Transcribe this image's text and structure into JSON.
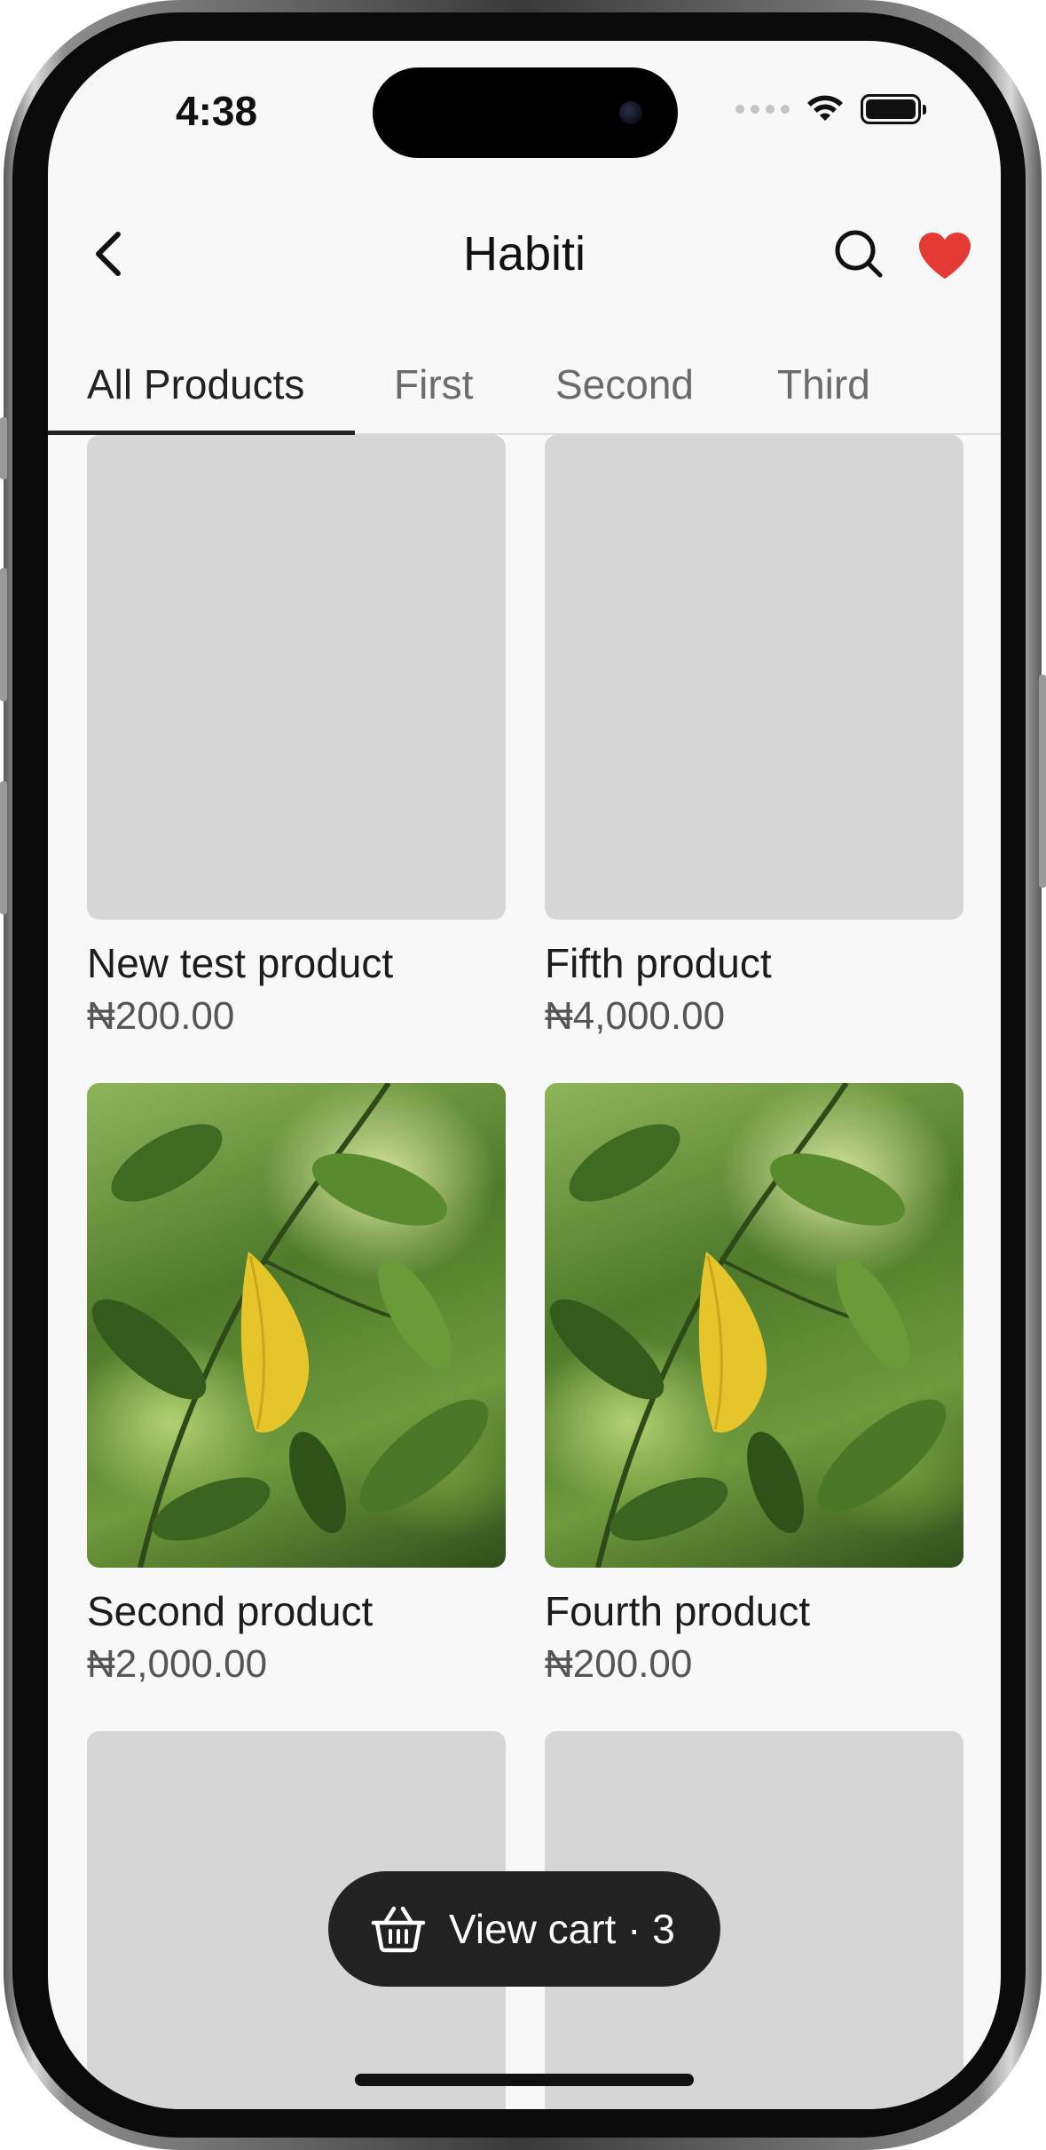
{
  "status_bar": {
    "time": "4:38"
  },
  "header": {
    "title": "Habiti"
  },
  "tabs": [
    {
      "label": "All Products",
      "active": true
    },
    {
      "label": "First",
      "active": false
    },
    {
      "label": "Second",
      "active": false
    },
    {
      "label": "Third",
      "active": false
    }
  ],
  "products": [
    {
      "name": "New test product",
      "price": "₦200.00",
      "image": "placeholder"
    },
    {
      "name": "Fifth product",
      "price": "₦4,000.00",
      "image": "placeholder"
    },
    {
      "name": "Second product",
      "price": "₦2,000.00",
      "image": "leaf-photo"
    },
    {
      "name": "Fourth product",
      "price": "₦200.00",
      "image": "leaf-photo"
    }
  ],
  "cart": {
    "label": "View cart · 3",
    "icon": "basket-icon"
  },
  "colors": {
    "background": "#f8f8f8",
    "placeholder": "#d6d6d6",
    "heart": "#e53935",
    "cart_pill": "#222222",
    "active_tab": "#222222",
    "inactive_tab": "#6b6b6b"
  }
}
